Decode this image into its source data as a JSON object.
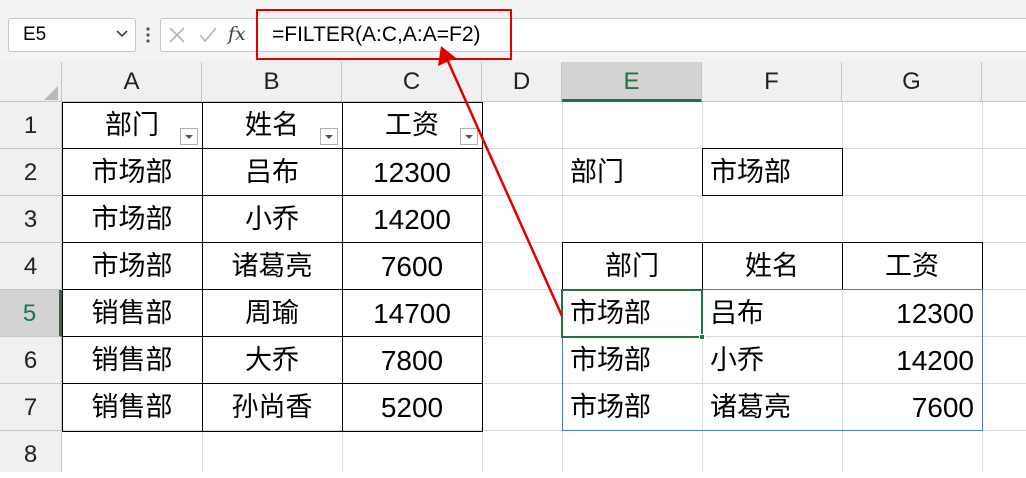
{
  "name_box": {
    "value": "E5"
  },
  "formula_bar": {
    "fx_label": "fx",
    "formula": "=FILTER(A:C,A:A=F2)"
  },
  "columns": [
    "A",
    "B",
    "C",
    "D",
    "E",
    "F",
    "G"
  ],
  "rows": [
    "1",
    "2",
    "3",
    "4",
    "5",
    "6",
    "7",
    "8"
  ],
  "selection": {
    "active_cell": "E5",
    "column": "E",
    "row": "5"
  },
  "source_table": {
    "headers": [
      "部门",
      "姓名",
      "工资"
    ],
    "rows": [
      [
        "市场部",
        "吕布",
        "12300"
      ],
      [
        "市场部",
        "小乔",
        "14200"
      ],
      [
        "市场部",
        "诸葛亮",
        "7600"
      ],
      [
        "销售部",
        "周瑜",
        "14700"
      ],
      [
        "销售部",
        "大乔",
        "7800"
      ],
      [
        "销售部",
        "孙尚香",
        "5200"
      ]
    ]
  },
  "criteria": {
    "label": "部门",
    "value": "市场部"
  },
  "result_table": {
    "headers": [
      "部门",
      "姓名",
      "工资"
    ],
    "rows": [
      [
        "市场部",
        "吕布",
        "12300"
      ],
      [
        "市场部",
        "小乔",
        "14200"
      ],
      [
        "市场部",
        "诸葛亮",
        "7600"
      ]
    ]
  },
  "colors": {
    "annotation": "#e00000",
    "selection": "#217346",
    "spill_border": "#4a78c2"
  },
  "icons": [
    "chevron-down-icon",
    "more-vertical-icon",
    "cancel-icon",
    "enter-icon",
    "function-icon",
    "filter-dropdown-icon",
    "select-all-icon"
  ]
}
